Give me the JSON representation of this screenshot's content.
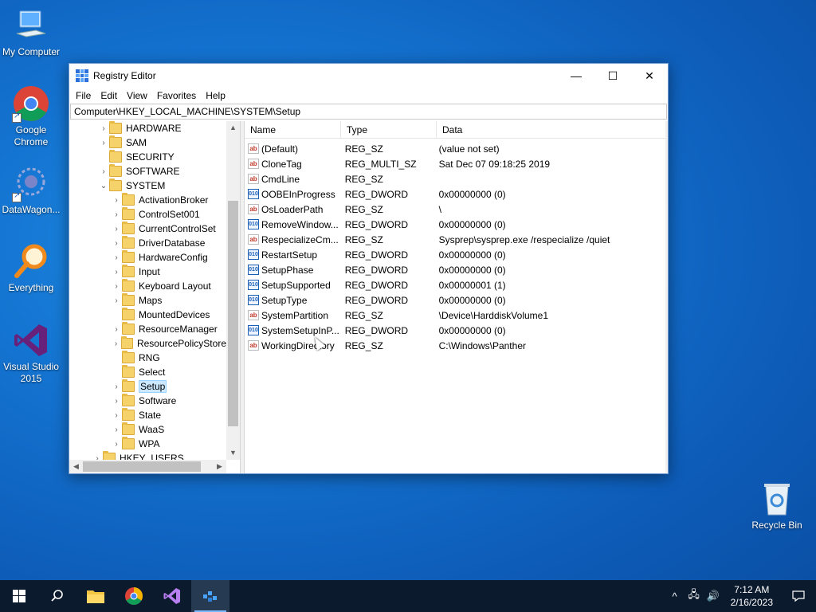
{
  "desktop": {
    "icons": [
      {
        "label": "My Computer",
        "icon": "monitor-icon"
      },
      {
        "label": "Google Chrome",
        "icon": "chrome-icon"
      },
      {
        "label": "DataWagon...",
        "icon": "datawagon-icon"
      },
      {
        "label": "Everything",
        "icon": "search-magnifier-icon"
      },
      {
        "label": "Visual Studio 2015",
        "icon": "visual-studio-icon"
      },
      {
        "label": "Recycle Bin",
        "icon": "recycle-bin-icon"
      }
    ]
  },
  "window": {
    "title": "Registry Editor",
    "controls": {
      "minimize": "—",
      "maximize": "☐",
      "close": "✕"
    },
    "menu": [
      "File",
      "Edit",
      "View",
      "Favorites",
      "Help"
    ],
    "address": "Computer\\HKEY_LOCAL_MACHINE\\SYSTEM\\Setup"
  },
  "tree": {
    "items": [
      {
        "label": "HARDWARE",
        "arrow": "›",
        "level": 1
      },
      {
        "label": "SAM",
        "arrow": "›",
        "level": 1
      },
      {
        "label": "SECURITY",
        "arrow": "",
        "level": 1
      },
      {
        "label": "SOFTWARE",
        "arrow": "›",
        "level": 1
      },
      {
        "label": "SYSTEM",
        "arrow": "⌄",
        "level": 1
      },
      {
        "label": "ActivationBroker",
        "arrow": "›",
        "level": 2
      },
      {
        "label": "ControlSet001",
        "arrow": "›",
        "level": 2
      },
      {
        "label": "CurrentControlSet",
        "arrow": "›",
        "level": 2
      },
      {
        "label": "DriverDatabase",
        "arrow": "›",
        "level": 2
      },
      {
        "label": "HardwareConfig",
        "arrow": "›",
        "level": 2
      },
      {
        "label": "Input",
        "arrow": "›",
        "level": 2
      },
      {
        "label": "Keyboard Layout",
        "arrow": "›",
        "level": 2
      },
      {
        "label": "Maps",
        "arrow": "›",
        "level": 2
      },
      {
        "label": "MountedDevices",
        "arrow": "",
        "level": 2
      },
      {
        "label": "ResourceManager",
        "arrow": "›",
        "level": 2
      },
      {
        "label": "ResourcePolicyStore",
        "arrow": "›",
        "level": 2
      },
      {
        "label": "RNG",
        "arrow": "",
        "level": 2
      },
      {
        "label": "Select",
        "arrow": "",
        "level": 2
      },
      {
        "label": "Setup",
        "arrow": "›",
        "level": 2,
        "selected": true
      },
      {
        "label": "Software",
        "arrow": "›",
        "level": 2
      },
      {
        "label": "State",
        "arrow": "›",
        "level": 2
      },
      {
        "label": "WaaS",
        "arrow": "›",
        "level": 2
      },
      {
        "label": "WPA",
        "arrow": "›",
        "level": 2
      },
      {
        "label": "HKEY_USERS",
        "arrow": "›",
        "level": 0
      }
    ]
  },
  "list": {
    "columns": {
      "name": "Name",
      "type": "Type",
      "data": "Data"
    },
    "rows": [
      {
        "name": "(Default)",
        "type": "REG_SZ",
        "data": "(value not set)",
        "icon": "sz"
      },
      {
        "name": "CloneTag",
        "type": "REG_MULTI_SZ",
        "data": "Sat Dec 07 09:18:25 2019",
        "icon": "sz"
      },
      {
        "name": "CmdLine",
        "type": "REG_SZ",
        "data": "",
        "icon": "sz"
      },
      {
        "name": "OOBEInProgress",
        "type": "REG_DWORD",
        "data": "0x00000000 (0)",
        "icon": "dw"
      },
      {
        "name": "OsLoaderPath",
        "type": "REG_SZ",
        "data": "\\",
        "icon": "sz"
      },
      {
        "name": "RemoveWindow...",
        "type": "REG_DWORD",
        "data": "0x00000000 (0)",
        "icon": "dw"
      },
      {
        "name": "RespecializeCm...",
        "type": "REG_SZ",
        "data": "Sysprep\\sysprep.exe /respecialize /quiet",
        "icon": "sz"
      },
      {
        "name": "RestartSetup",
        "type": "REG_DWORD",
        "data": "0x00000000 (0)",
        "icon": "dw"
      },
      {
        "name": "SetupPhase",
        "type": "REG_DWORD",
        "data": "0x00000000 (0)",
        "icon": "dw"
      },
      {
        "name": "SetupSupported",
        "type": "REG_DWORD",
        "data": "0x00000001 (1)",
        "icon": "dw"
      },
      {
        "name": "SetupType",
        "type": "REG_DWORD",
        "data": "0x00000000 (0)",
        "icon": "dw"
      },
      {
        "name": "SystemPartition",
        "type": "REG_SZ",
        "data": "\\Device\\HarddiskVolume1",
        "icon": "sz"
      },
      {
        "name": "SystemSetupInP...",
        "type": "REG_DWORD",
        "data": "0x00000000 (0)",
        "icon": "dw"
      },
      {
        "name": "WorkingDirectory",
        "type": "REG_SZ",
        "data": "C:\\Windows\\Panther",
        "icon": "sz"
      }
    ],
    "icon_glyphs": {
      "sz": "ab",
      "dw": "010"
    }
  },
  "taskbar": {
    "apps": [
      "start",
      "search",
      "file-explorer",
      "chrome",
      "visual-studio",
      "registry-editor"
    ],
    "tray": {
      "chevron": "^",
      "network": "🖧",
      "volume": "🔊"
    },
    "time": "7:12 AM",
    "date": "2/16/2023"
  },
  "colors": {
    "accent": "#0078d7",
    "taskbar": "#0c1a2e",
    "selection": "#cce8ff"
  }
}
